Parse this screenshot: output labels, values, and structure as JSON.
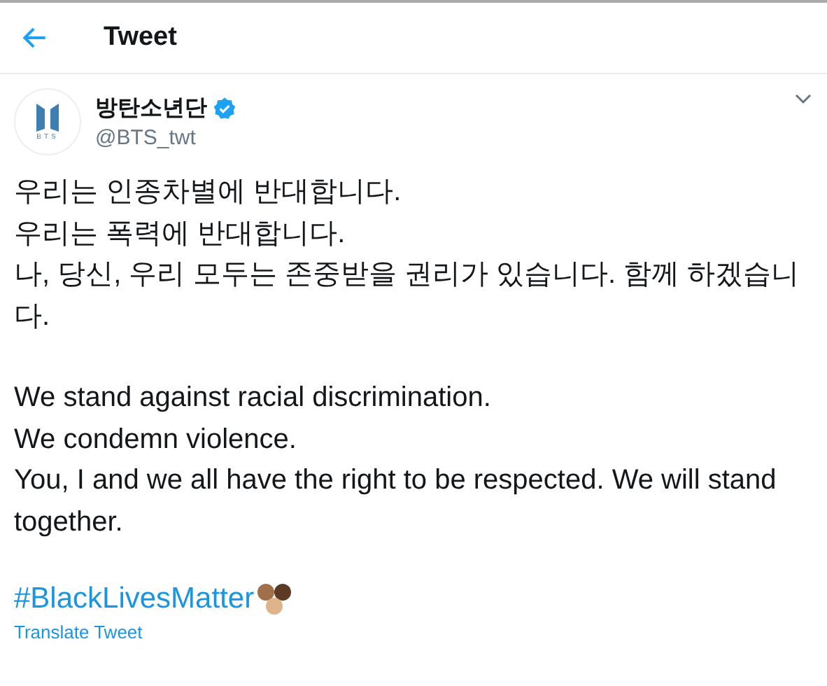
{
  "header": {
    "title": "Tweet"
  },
  "author": {
    "name": "방탄소년단",
    "handle": "@BTS_twt",
    "verified": true,
    "logo_text": "BTS"
  },
  "paragraphs": [
    [
      "우리는 인종차별에 반대합니다.",
      "우리는 폭력에 반대합니다.",
      "나, 당신, 우리 모두는 존중받을 권리가 있습니다. 함께 하겠습니다."
    ],
    [
      "We stand against racial discrimination.",
      "We condemn violence.",
      "You, I and we all have the right to be respected. We will stand together."
    ]
  ],
  "hashtag": "#BlackLivesMatter",
  "translate": "Translate Tweet"
}
